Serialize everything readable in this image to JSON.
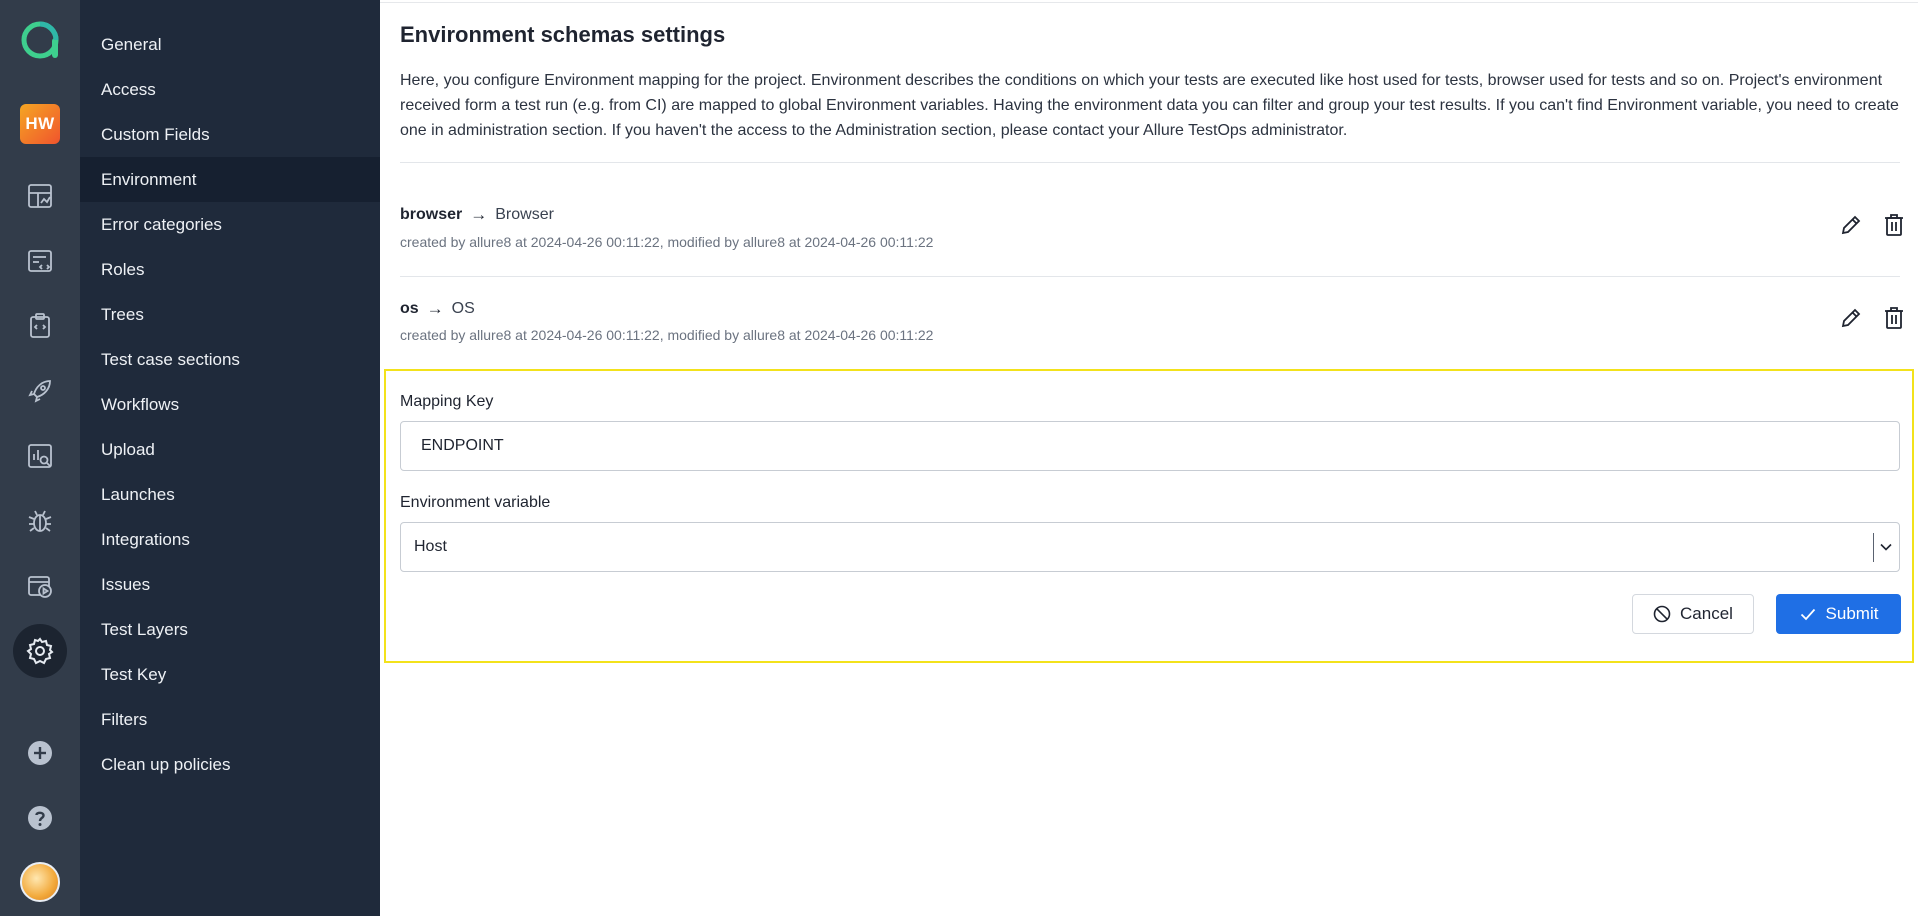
{
  "rail": {
    "icons": [
      "allure-logo-icon",
      "project-avatar",
      "dashboard-icon",
      "test-cases-icon",
      "test-plans-icon",
      "launches-icon",
      "analytics-icon",
      "defects-icon",
      "jobs-icon",
      "settings-icon",
      "add-project-icon",
      "help-icon",
      "user-avatar"
    ],
    "project_initials": "HW",
    "accent": "#3ecf8e"
  },
  "settings_menu": {
    "items": [
      {
        "label": "General"
      },
      {
        "label": "Access"
      },
      {
        "label": "Custom Fields"
      },
      {
        "label": "Environment",
        "active": true
      },
      {
        "label": "Error categories"
      },
      {
        "label": "Roles"
      },
      {
        "label": "Trees"
      },
      {
        "label": "Test case sections"
      },
      {
        "label": "Workflows"
      },
      {
        "label": "Upload"
      },
      {
        "label": "Launches"
      },
      {
        "label": "Integrations"
      },
      {
        "label": "Issues"
      },
      {
        "label": "Test Layers"
      },
      {
        "label": "Test Key"
      },
      {
        "label": "Filters"
      },
      {
        "label": "Clean up policies"
      }
    ]
  },
  "main": {
    "title": "Environment schemas settings",
    "description": "Here, you configure Environment mapping for the project. Environment describes the conditions on which your tests are executed like host used for tests, browser used for tests and so on. Project's environment received form a test run (e.g. from CI) are mapped to global Environment variables. Having the environment data you can filter and group your test results. If you can't find Environment variable, you need to create one in administration section. If you haven't the access to the Administration section, please contact your Allure TestOps administrator.",
    "mappings": [
      {
        "key": "browser",
        "arrow": "→",
        "variable": "Browser",
        "meta": "created by allure8 at 2024-04-26 00:11:22, modified by allure8 at 2024-04-26 00:11:22"
      },
      {
        "key": "os",
        "arrow": "→",
        "variable": "OS",
        "meta": "created by allure8 at 2024-04-26 00:11:22, modified by allure8 at 2024-04-26 00:11:22"
      }
    ],
    "form": {
      "mapping_key_label": "Mapping Key",
      "mapping_key_value": "ENDPOINT",
      "env_var_label": "Environment variable",
      "env_var_value": "Host",
      "cancel_label": "Cancel",
      "submit_label": "Submit",
      "highlight_color": "#f3e21b",
      "submit_color": "#1f6fe5"
    }
  }
}
